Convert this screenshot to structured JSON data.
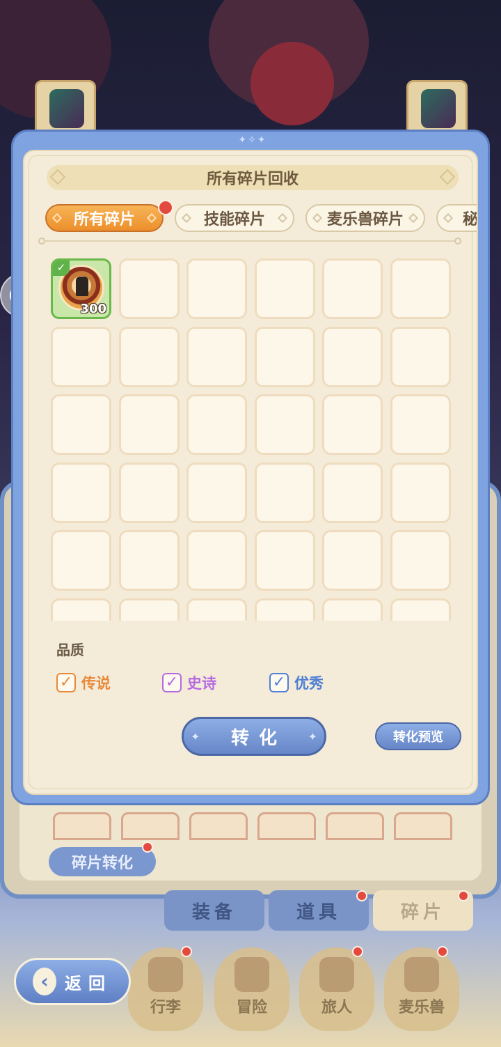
{
  "dialog": {
    "title": "所有碎片回收",
    "tabs": [
      {
        "label": "所有碎片",
        "active": true,
        "badge": true
      },
      {
        "label": "技能碎片",
        "active": false
      },
      {
        "label": "麦乐兽碎片",
        "active": false
      },
      {
        "label": "秘",
        "active": false
      }
    ],
    "grid": {
      "items": [
        {
          "count": "300",
          "selected": true,
          "icon": "fragment-item-icon"
        }
      ]
    },
    "quality": {
      "label": "品质",
      "options": [
        {
          "label": "传说",
          "checked": true,
          "color": "#e8893a"
        },
        {
          "label": "史诗",
          "checked": true,
          "color": "#b66ae0"
        },
        {
          "label": "优秀",
          "checked": true,
          "color": "#4f7fd6"
        }
      ]
    },
    "convert_label": "转化",
    "preview_label": "转化预览"
  },
  "background_panel": {
    "fragment_convert_label": "碎片转化",
    "tabs": [
      "装备",
      "道具",
      "碎片"
    ]
  },
  "bottom_nav": {
    "back_label": "返回",
    "items": [
      "行李",
      "冒险",
      "旅人",
      "麦乐兽"
    ]
  },
  "colors": {
    "accent_blue": "#7fa3e0",
    "active_tab_orange": "#ec8f2b",
    "panel_cream": "#f4ecd9",
    "selected_green": "#69b94a",
    "badge_red": "#e34a3f"
  }
}
